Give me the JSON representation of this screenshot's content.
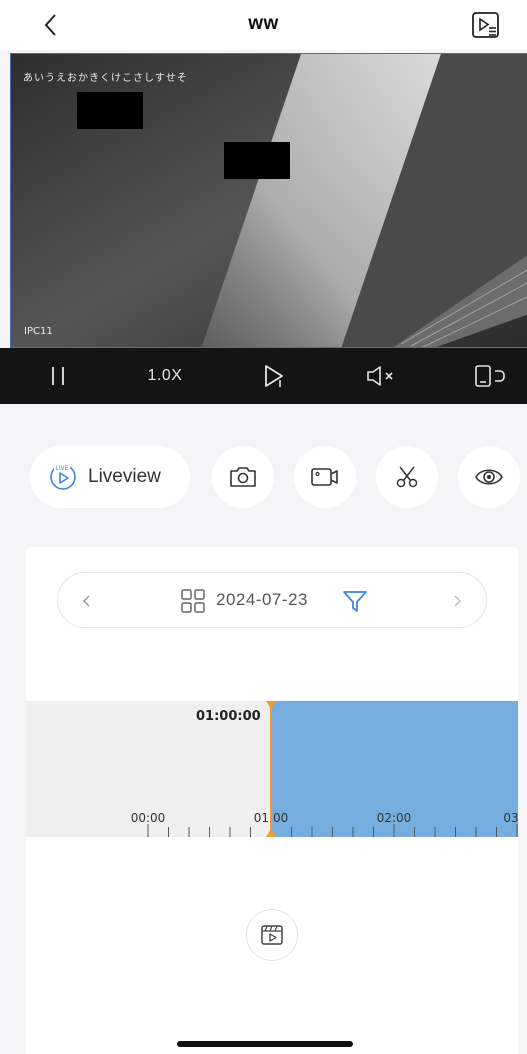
{
  "header": {
    "title": "ww",
    "back_icon": "chevron-left-icon",
    "playlist_icon": "playlist-icon"
  },
  "video": {
    "osd_text": "あいうえおかきくけこさしすせそ",
    "camera_name": "IPC11"
  },
  "controls": {
    "pause_icon": "pause-icon",
    "speed": "1.0X",
    "play_icon": "play-icon",
    "mute_icon": "mute-icon",
    "rotate_icon": "rotate-screen-icon"
  },
  "actions": {
    "liveview_label": "Liveview",
    "liveview_badge": "LIVE",
    "snapshot_icon": "camera-icon",
    "record_icon": "video-record-icon",
    "clip_icon": "scissors-icon",
    "eye_icon": "eye-icon"
  },
  "datebar": {
    "date": "2024-07-23",
    "grid_icon": "grid-icon",
    "filter_icon": "filter-icon"
  },
  "timeline": {
    "cursor_time": "01:00:00",
    "labels": [
      "00:00",
      "01:00",
      "02:00",
      "03"
    ],
    "recorded_from": "01:00",
    "colors": {
      "recorded": "#75aede",
      "cursor": "#f39a2b"
    }
  },
  "footer": {
    "clip_list_icon": "clip-list-icon"
  }
}
